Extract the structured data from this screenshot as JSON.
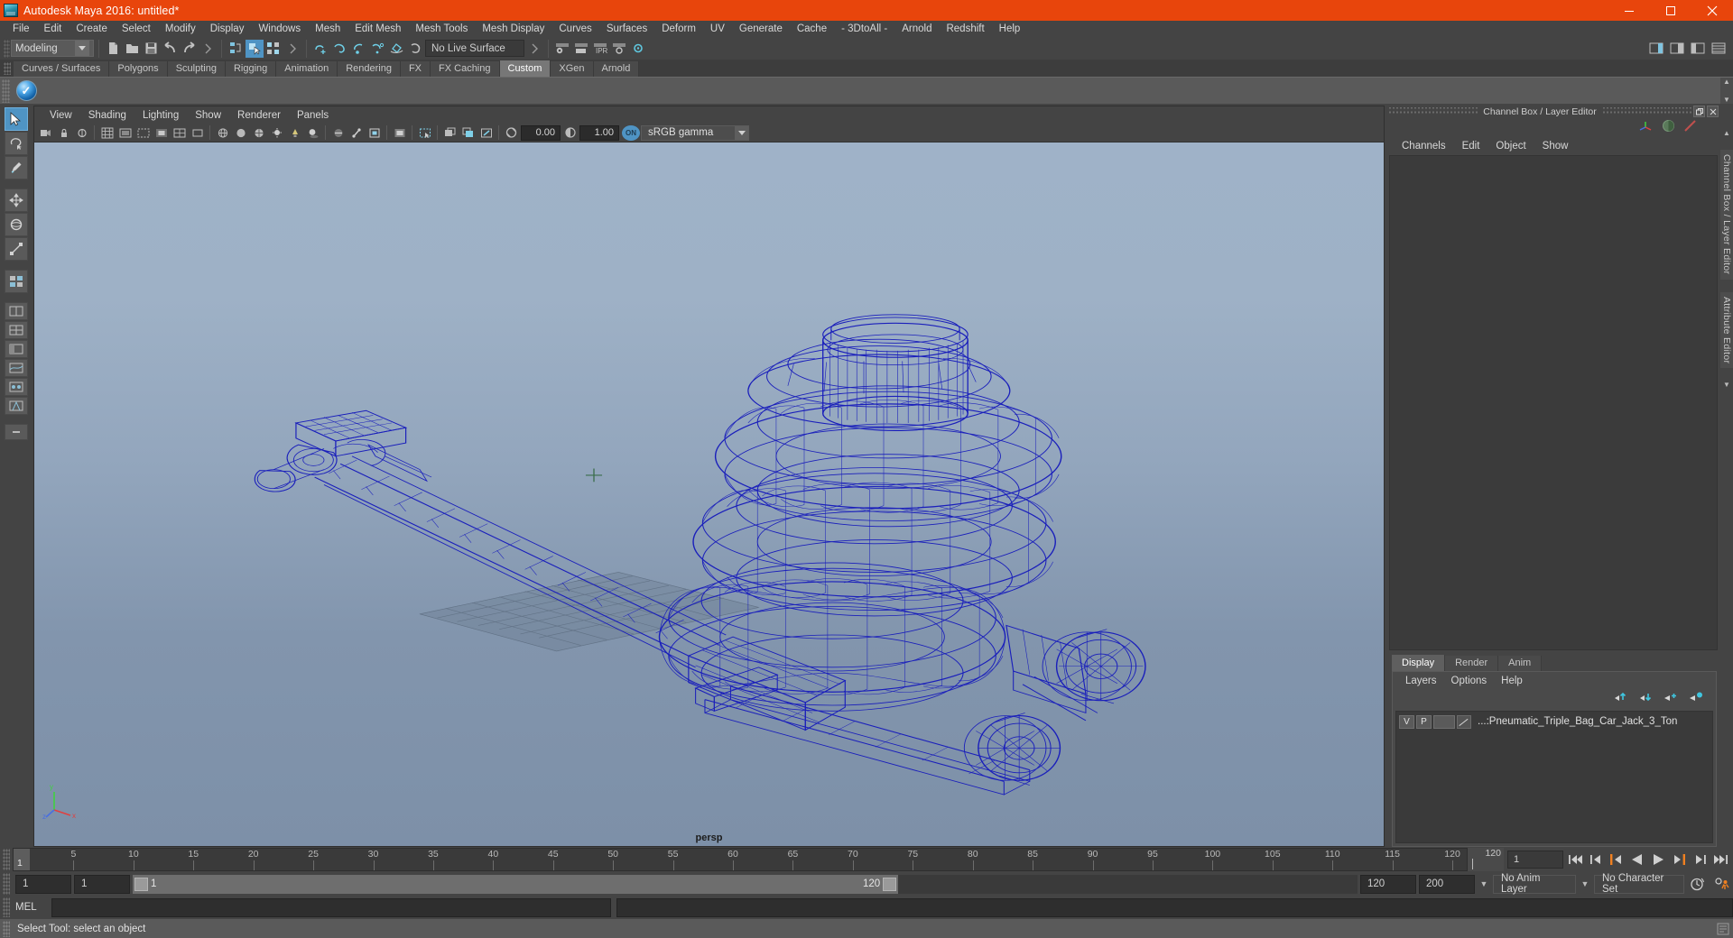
{
  "titlebar": {
    "title": "Autodesk Maya 2016: untitled*",
    "icon": "maya-app-icon",
    "minimize": "minimize-icon",
    "maximize": "maximize-icon",
    "close": "close-icon"
  },
  "menubar": {
    "items": [
      "File",
      "Edit",
      "Create",
      "Select",
      "Modify",
      "Display",
      "Windows",
      "Mesh",
      "Edit Mesh",
      "Mesh Tools",
      "Mesh Display",
      "Curves",
      "Surfaces",
      "Deform",
      "UV",
      "Generate",
      "Cache",
      "- 3DtoAll -",
      "Arnold",
      "Redshift",
      "Help"
    ]
  },
  "statusline": {
    "menuset": "Modeling",
    "live_surface": "No Live Surface",
    "icons": [
      "new-scene-icon",
      "open-scene-icon",
      "save-scene-icon",
      "undo-icon",
      "redo-icon",
      "select-hierarchy-icon",
      "select-object-icon",
      "select-component-icon",
      "snap-grid-icon",
      "snap-curve-icon",
      "snap-point-icon",
      "snap-projected-icon",
      "snap-view-plane-icon",
      "make-live-icon",
      "show-manipulator-icon",
      "render-globals-icon",
      "hypershade-icon",
      "render-view-icon",
      "ipr-icon",
      "render-sequence-icon",
      "sidebar-attr-icon",
      "sidebar-tool-icon",
      "sidebar-channel-icon",
      "sidebar-layer-icon"
    ]
  },
  "shelf": {
    "tabs": [
      "Curves / Surfaces",
      "Polygons",
      "Sculpting",
      "Rigging",
      "Animation",
      "Rendering",
      "FX",
      "FX Caching",
      "Custom",
      "XGen",
      "Arnold"
    ],
    "selected_tab": "Custom",
    "buttons": [
      "blue-check-badge-icon"
    ],
    "scroll_up": "scroll-up-icon",
    "scroll_down": "scroll-down-icon"
  },
  "toolbox": {
    "tools": [
      "select-tool",
      "lasso-select-tool",
      "paint-select-tool",
      "move-tool",
      "rotate-tool",
      "scale-tool",
      "last-tool",
      "layout-single-icon",
      "layout-four-view-icon",
      "layout-persp-outliner-icon",
      "layout-persp-graph-icon",
      "layout-hypershade-icon",
      "layout-persp-uv-icon",
      "layout-more-icon"
    ],
    "selected": "select-tool"
  },
  "viewport": {
    "menus": [
      "View",
      "Shading",
      "Lighting",
      "Show",
      "Renderer",
      "Panels"
    ],
    "camera_label": "persp",
    "toolbar": {
      "exposure_value": "0.00",
      "gamma_value": "1.00",
      "color_toggle": "ON",
      "color_profile": "sRGB gamma",
      "icons": [
        "select-camera-icon",
        "lock-camera-icon",
        "camera-attributes-icon",
        "bookmark-icon",
        "image-plane-icon",
        "two-d-pan-zoom-icon",
        "grid-toggle-icon",
        "film-gate-icon",
        "resolution-gate-icon",
        "gate-mask-icon",
        "field-chart-icon",
        "safe-action-icon",
        "safe-title-icon",
        "wireframe-icon",
        "smooth-shade-icon",
        "textured-icon",
        "use-lights-icon",
        "shadows-icon",
        "ao-icon",
        "motion-blur-icon",
        "multisample-icon",
        "depth-peel-icon",
        "xray-icon",
        "xray-joints-icon",
        "xray-active-icon",
        "isolate-select-icon",
        "grid-snap-icon",
        "exposure-icon",
        "gamma-icon",
        "color-management-toggle"
      ]
    },
    "axis_gizmo": {
      "x": "x",
      "y": "y",
      "z": "z"
    },
    "model_name": "Pneumatic Triple Bag Car Jack wireframe"
  },
  "channelbox": {
    "panel_title": "Channel Box / Layer Editor",
    "menus": [
      "Channels",
      "Edit",
      "Object",
      "Show"
    ],
    "header_icons": [
      "channel-box-icon",
      "attribute-editor-icon",
      "layer-editor-icon"
    ],
    "restore_button": "restore-panel-icon",
    "close_button": "close-panel-icon"
  },
  "layereditor": {
    "tabs": [
      "Display",
      "Render",
      "Anim"
    ],
    "selected_tab": "Display",
    "menus": [
      "Layers",
      "Options",
      "Help"
    ],
    "toolbar_icons": [
      "move-layer-up-icon",
      "move-layer-down-icon",
      "new-layer-icon",
      "new-layer-from-selected-icon"
    ],
    "layers": [
      {
        "visibility": "V",
        "playback": "P",
        "shading": "",
        "color_swatch": "layer-color-swatch",
        "name": "...:Pneumatic_Triple_Bag_Car_Jack_3_Ton"
      }
    ]
  },
  "sidetabs": {
    "items": [
      "Channel Box / Layer Editor",
      "Attribute Editor"
    ],
    "scroll_up": "scroll-up-arrow",
    "scroll_down": "scroll-down-arrow"
  },
  "timeslider": {
    "current_frame": "1",
    "current_frame_field": "1",
    "end_marker": "120",
    "ticks": [
      5,
      10,
      15,
      20,
      25,
      30,
      35,
      40,
      45,
      50,
      55,
      60,
      65,
      70,
      75,
      80,
      85,
      90,
      95,
      100,
      105,
      110,
      115,
      120
    ],
    "playback_buttons": [
      "go-to-start-icon",
      "step-back-keyframe-icon",
      "step-back-frame-icon",
      "play-backwards-icon",
      "play-forwards-icon",
      "step-forward-frame-icon",
      "step-forward-keyframe-icon",
      "go-to-end-icon"
    ]
  },
  "rangeslider": {
    "anim_start": "1",
    "range_start": "1",
    "bar_start_label": "1",
    "bar_end_label": "120",
    "range_end": "120",
    "anim_end": "200",
    "anim_layer": "No Anim Layer",
    "character_set": "No Character Set",
    "auto_key_icon": "auto-keyframe-icon",
    "anim_prefs_icon": "animation-preferences-icon"
  },
  "commandline": {
    "language_label": "MEL",
    "input_value": "",
    "output_value": ""
  },
  "statusbar": {
    "help_text": "Select Tool: select an object",
    "right_icon": "script-editor-icon"
  },
  "colors": {
    "title_bar": "#e8450c",
    "accent_blue": "#4f94c4",
    "panel_bg": "#444444",
    "field_bg": "#2e2e2e",
    "wireframe": "#1a1fbb",
    "viewport_top": "#9fb2c8",
    "viewport_bottom": "#7d90a8",
    "orange_marker": "#f08020"
  }
}
